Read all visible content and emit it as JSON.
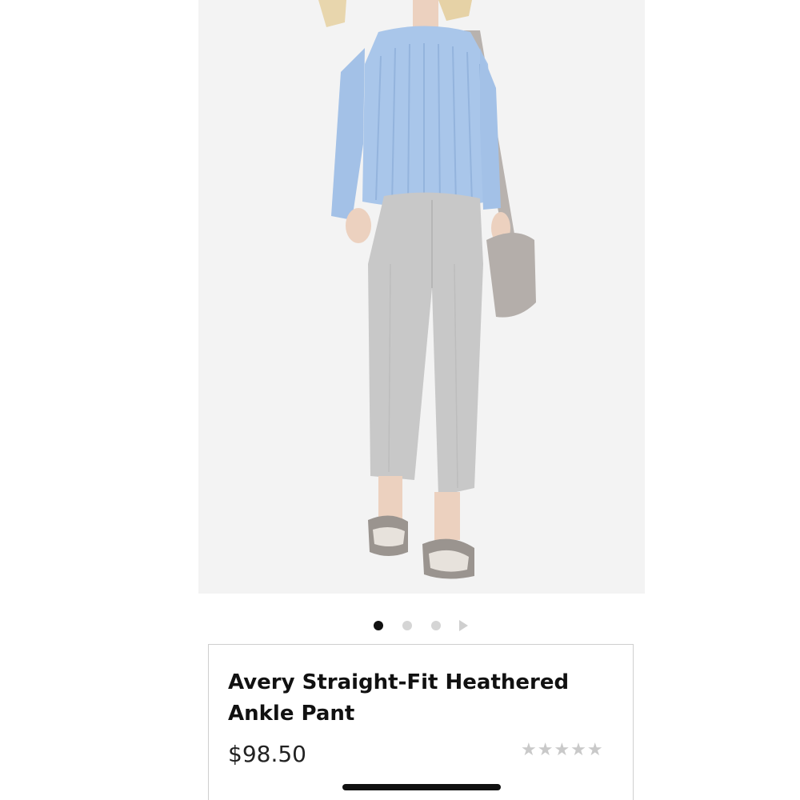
{
  "product": {
    "image_alt": "Model wearing light gray ankle pants with a light blue ribbed sweater and a gray shoulder bag",
    "title": "Avery Straight-Fit Heathered Ankle Pant",
    "price": "$98.50",
    "rating_stars": "★★★★★",
    "rating_value": 0,
    "rating_max": 5
  },
  "carousel": {
    "total_images": 3,
    "active_index": 0,
    "next_icon": "play-arrow-icon"
  },
  "colors": {
    "sweater": "#a9c6ea",
    "pants": "#c8c8c8",
    "bag": "#b4aeaa",
    "background": "#f3f3f3",
    "active_dot": "#111111",
    "inactive_dot": "#d5d5d5",
    "stars": "#c9c9c9"
  }
}
